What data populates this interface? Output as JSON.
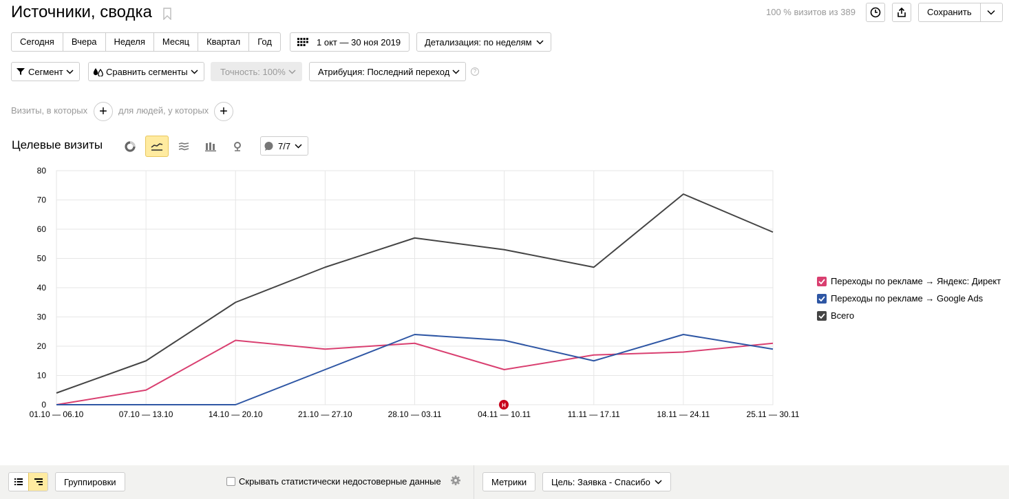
{
  "header": {
    "title": "Источники, сводка",
    "visits_info": "100 % визитов из 389",
    "save_label": "Сохранить"
  },
  "periods": [
    "Сегодня",
    "Вчера",
    "Неделя",
    "Месяц",
    "Квартал",
    "Год"
  ],
  "date_range": "1 окт — 30 ноя 2019",
  "detail_label": "Детализация: по неделям",
  "controls": {
    "segment": "Сегмент",
    "compare": "Сравнить сегменты",
    "accuracy": "Точность: 100%",
    "attribution": "Атрибуция: Последний переход",
    "help": "?"
  },
  "conditions": {
    "visits": "Визиты, в которых",
    "people": "для людей, у которых"
  },
  "chart_section": {
    "title": "Целевые визиты",
    "notes_count": "7/7",
    "marker_label": "Н"
  },
  "chart_data": {
    "type": "line",
    "categories": [
      "01.10 — 06.10",
      "07.10 — 13.10",
      "14.10 — 20.10",
      "21.10 — 27.10",
      "28.10 — 03.11",
      "04.11 — 10.11",
      "11.11 — 17.11",
      "18.11 — 24.11",
      "25.11 — 30.11"
    ],
    "series": [
      {
        "name": "Переходы по рекламе → Яндекс: Директ",
        "color": "#d93f70",
        "values": [
          0,
          5,
          22,
          19,
          21,
          12,
          17,
          18,
          21
        ]
      },
      {
        "name": "Переходы по рекламе → Google Ads",
        "color": "#2e56a4",
        "values": [
          0,
          0,
          0,
          12,
          24,
          22,
          15,
          24,
          19
        ]
      },
      {
        "name": "Всего",
        "color": "#444444",
        "values": [
          4,
          15,
          35,
          47,
          57,
          53,
          47,
          72,
          59
        ]
      }
    ],
    "ylim": [
      0,
      80
    ],
    "yticks": [
      0,
      10,
      20,
      30,
      40,
      50,
      60,
      70,
      80
    ],
    "grid": true,
    "legend_position": "right"
  },
  "footer": {
    "groupings": "Группировки",
    "hide_stat": "Скрывать статистически недостоверные данные",
    "metrics": "Метрики",
    "goal": "Цель: Заявка - Спасибо"
  }
}
